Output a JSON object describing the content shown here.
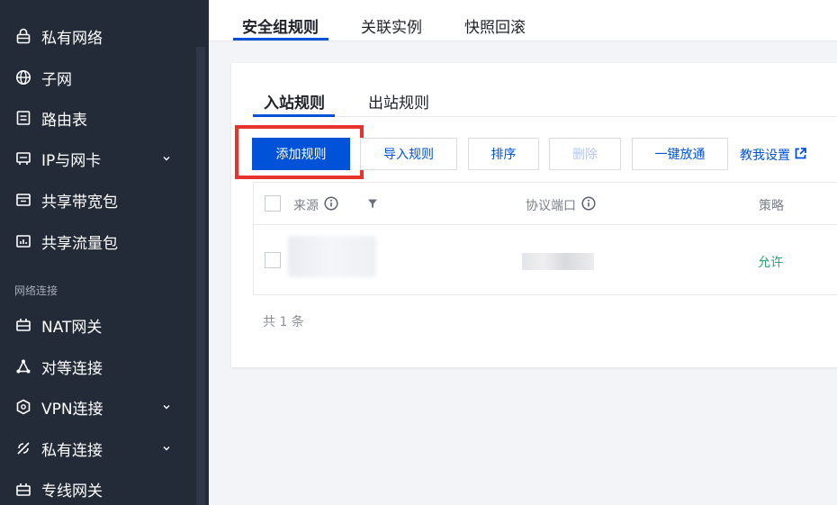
{
  "sidebar": {
    "items": [
      {
        "label": "私有网络",
        "icon": "lock-icon"
      },
      {
        "label": "子网",
        "icon": "globe-icon"
      },
      {
        "label": "路由表",
        "icon": "route-table-icon"
      },
      {
        "label": "IP与网卡",
        "icon": "network-card-icon",
        "expandable": true
      },
      {
        "label": "共享带宽包",
        "icon": "bandwidth-package-icon"
      },
      {
        "label": "共享流量包",
        "icon": "traffic-package-icon"
      }
    ],
    "group_label": "网络连接",
    "group_items": [
      {
        "label": "NAT网关",
        "icon": "nat-gateway-icon"
      },
      {
        "label": "对等连接",
        "icon": "peering-icon"
      },
      {
        "label": "VPN连接",
        "icon": "vpn-icon",
        "expandable": true
      },
      {
        "label": "私有连接",
        "icon": "private-link-icon",
        "expandable": true
      },
      {
        "label": "专线网关",
        "icon": "dedicated-gateway-icon"
      }
    ]
  },
  "top_tabs": [
    {
      "label": "安全组规则",
      "active": true
    },
    {
      "label": "关联实例",
      "active": false
    },
    {
      "label": "快照回滚",
      "active": false
    }
  ],
  "sub_tabs": [
    {
      "label": "入站规则",
      "active": true
    },
    {
      "label": "出站规则",
      "active": false
    }
  ],
  "toolbar": {
    "add_rule": "添加规则",
    "import_rule": "导入规则",
    "sort": "排序",
    "delete": "删除",
    "allow_all": "一键放通",
    "help_link": "教我设置"
  },
  "table": {
    "headers": {
      "source": "来源",
      "protocol_port": "协议端口",
      "policy": "策略"
    },
    "rows": [
      {
        "policy": "允许"
      }
    ]
  },
  "pagination": {
    "total": "共 1 条"
  },
  "colors": {
    "sidebar_bg": "#242b38",
    "primary": "#0052d9",
    "highlight": "#e8332a",
    "allow_green": "#2ba471"
  }
}
